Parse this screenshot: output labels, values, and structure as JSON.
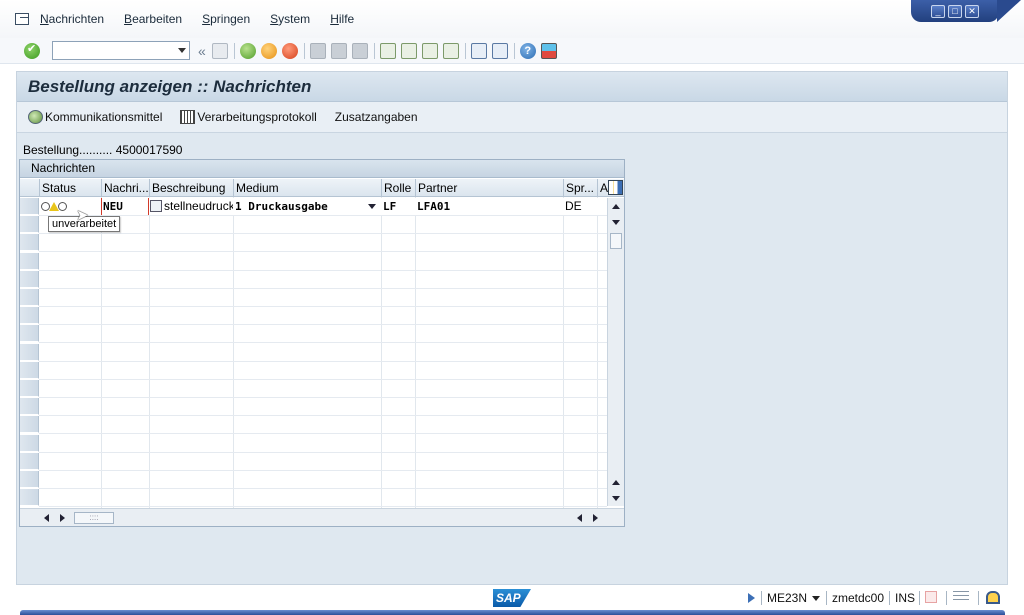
{
  "menu": {
    "items": [
      {
        "label": "Nachrichten",
        "underline": "N",
        "rest": "achrichten"
      },
      {
        "label": "Bearbeiten",
        "underline": "B",
        "rest": "earbeiten"
      },
      {
        "label": "Springen",
        "underline": "S",
        "rest": "pringen"
      },
      {
        "label": "System",
        "underline": "S",
        "rest": "ystem"
      },
      {
        "label": "Hilfe",
        "underline": "H",
        "rest": "ilfe"
      }
    ]
  },
  "toolbar": {
    "command_value": "",
    "back_glyph": "«",
    "help_glyph": "?"
  },
  "screen": {
    "title": "Bestellung anzeigen :: Nachrichten",
    "app_toolbar": {
      "kommunikation": "Kommunikationsmittel",
      "verarbeitung": "Verarbeitungsprotokoll",
      "zusatz": "Zusatzangaben"
    },
    "field": {
      "label": "Bestellung..........",
      "value": "4500017590"
    }
  },
  "grid": {
    "title": "Nachrichten",
    "columns": [
      "Status",
      "Nachri...",
      "Beschreibung",
      "Medium",
      "Rolle",
      "Partner",
      "Spr...",
      "A"
    ],
    "rows": [
      {
        "nachricht": "NEU",
        "beschreibung": "stellneudruck",
        "medium": "1 Druckausgabe",
        "rolle": "LF",
        "partner": "LFA01",
        "sprache": "DE"
      }
    ],
    "tooltip": "unverarbeitet",
    "hthumb": "::::"
  },
  "status": {
    "logo": "SAP",
    "transaction": "ME23N",
    "server": "zmetdc00",
    "mode": "INS"
  },
  "colors": {
    "title_bg": "#c9d8e6",
    "main_bg": "#dfe8f0",
    "accent_blue": "#2c4f98",
    "new_marker": "#d23a2a"
  }
}
